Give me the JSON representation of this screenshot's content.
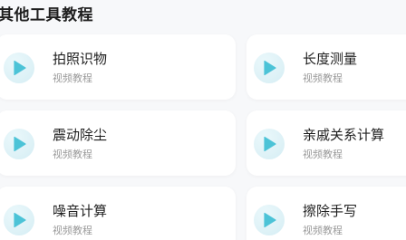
{
  "section": {
    "title": "其他工具教程"
  },
  "cards": [
    {
      "name": "拍照识物",
      "sub": "视频教程",
      "icon": "play-icon"
    },
    {
      "name": "长度测量",
      "sub": "视频教程",
      "icon": "play-icon"
    },
    {
      "name": "震动除尘",
      "sub": "视频教程",
      "icon": "play-icon"
    },
    {
      "name": "亲戚关系计算",
      "sub": "视频教程",
      "icon": "play-icon"
    },
    {
      "name": "噪音计算",
      "sub": "视频教程",
      "icon": "play-icon"
    },
    {
      "name": "擦除手写",
      "sub": "视频教程",
      "icon": "play-icon"
    }
  ],
  "colors": {
    "accent": "#4cc3d7",
    "icon_bg": "#dff2f7",
    "card_bg": "#ffffff",
    "page_bg": "#f7f8fa"
  }
}
